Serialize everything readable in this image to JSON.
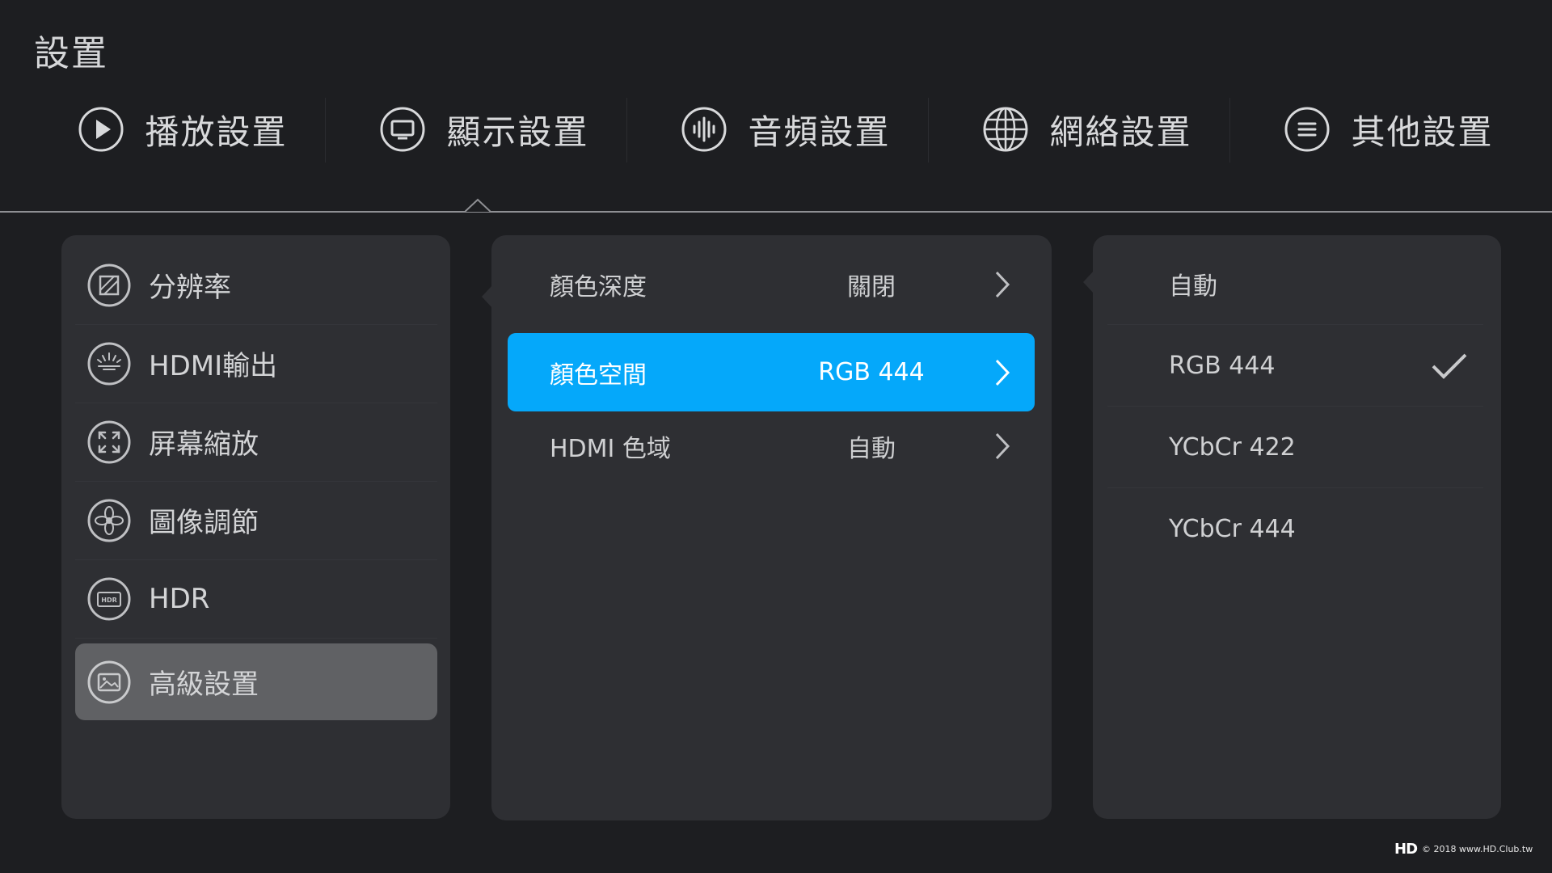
{
  "page": {
    "title": "設置"
  },
  "tabs": [
    {
      "label": "播放設置",
      "icon": "play-icon"
    },
    {
      "label": "顯示設置",
      "icon": "display-icon"
    },
    {
      "label": "音頻設置",
      "icon": "audio-wave-icon"
    },
    {
      "label": "網絡設置",
      "icon": "globe-icon"
    },
    {
      "label": "其他設置",
      "icon": "menu-lines-icon"
    }
  ],
  "active_tab": "顯示設置",
  "display_menu": {
    "items": [
      {
        "label": "分辨率",
        "icon": "resolution-icon"
      },
      {
        "label": "HDMI輸出",
        "icon": "hdmi-output-icon"
      },
      {
        "label": "屏幕縮放",
        "icon": "screen-zoom-icon"
      },
      {
        "label": "圖像調節",
        "icon": "image-adjust-icon"
      },
      {
        "label": "HDR",
        "icon": "hdr-icon"
      },
      {
        "label": "高級設置",
        "icon": "advanced-image-icon"
      }
    ],
    "selected": "高級設置"
  },
  "advanced_options": {
    "items": [
      {
        "label": "顏色深度",
        "value": "關閉"
      },
      {
        "label": "顏色空間",
        "value": "RGB 444"
      },
      {
        "label": "HDMI 色域",
        "value": "自動"
      }
    ],
    "selected": "顏色空間"
  },
  "color_space_choices": {
    "items": [
      "自動",
      "RGB 444",
      "YCbCr 422",
      "YCbCr 444"
    ],
    "checked": "RGB 444"
  },
  "colors": {
    "background": "#1d1e21",
    "panel": "#2e2f33",
    "accent": "#05a8fa",
    "selected_menu": "#606164"
  },
  "watermark": {
    "logo": "HD",
    "text": "© 2018 www.HD.Club.tw"
  }
}
